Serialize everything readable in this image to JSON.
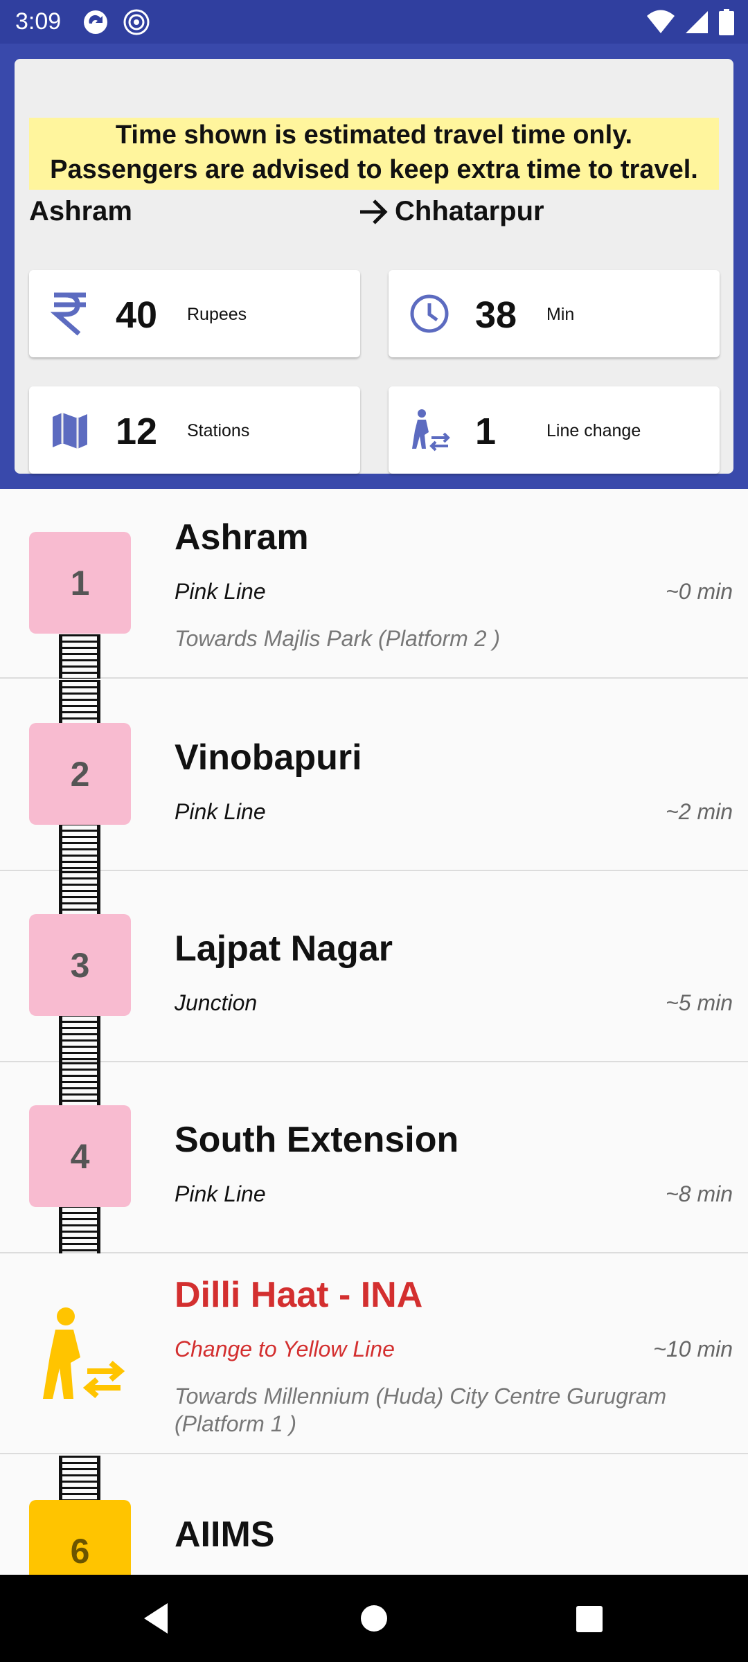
{
  "status": {
    "time": "3:09"
  },
  "notice": {
    "line1": "Time shown is estimated travel time only.",
    "line2": "Passengers are advised to keep extra time to travel."
  },
  "route": {
    "from": "Ashram",
    "to": "Chhatarpur"
  },
  "summary": {
    "fare": {
      "value": "40",
      "label": "Rupees",
      "icon": "rupee-icon"
    },
    "time": {
      "value": "38",
      "label": "Min",
      "icon": "clock-icon"
    },
    "stations": {
      "value": "12",
      "label": "Stations",
      "icon": "map-icon"
    },
    "changes": {
      "value": "1",
      "label": "Line change",
      "icon": "line-change-icon"
    }
  },
  "stations": [
    {
      "num": "1",
      "name": "Ashram",
      "line": "Pink Line",
      "time": "~0 min",
      "direction": "Towards Majlis Park (Platform 2 )"
    },
    {
      "num": "2",
      "name": "Vinobapuri",
      "line": "Pink Line",
      "time": "~2 min"
    },
    {
      "num": "3",
      "name": "Lajpat Nagar",
      "line": "Junction",
      "time": "~5 min"
    },
    {
      "num": "4",
      "name": "South Extension",
      "line": "Pink Line",
      "time": "~8 min"
    },
    {
      "num": "",
      "name": "Dilli Haat - INA",
      "line": "Change to Yellow Line",
      "time": "~10 min",
      "direction": "Towards Millennium (Huda) City Centre Gurugram (Platform 1 )",
      "icon": "interchange-icon"
    },
    {
      "num": "6",
      "name": "AIIMS"
    }
  ],
  "colors": {
    "pink": "#f8bbd0",
    "yellow": "#ffc400",
    "interchange_red": "#d32f2f",
    "header": "#3949ab"
  }
}
